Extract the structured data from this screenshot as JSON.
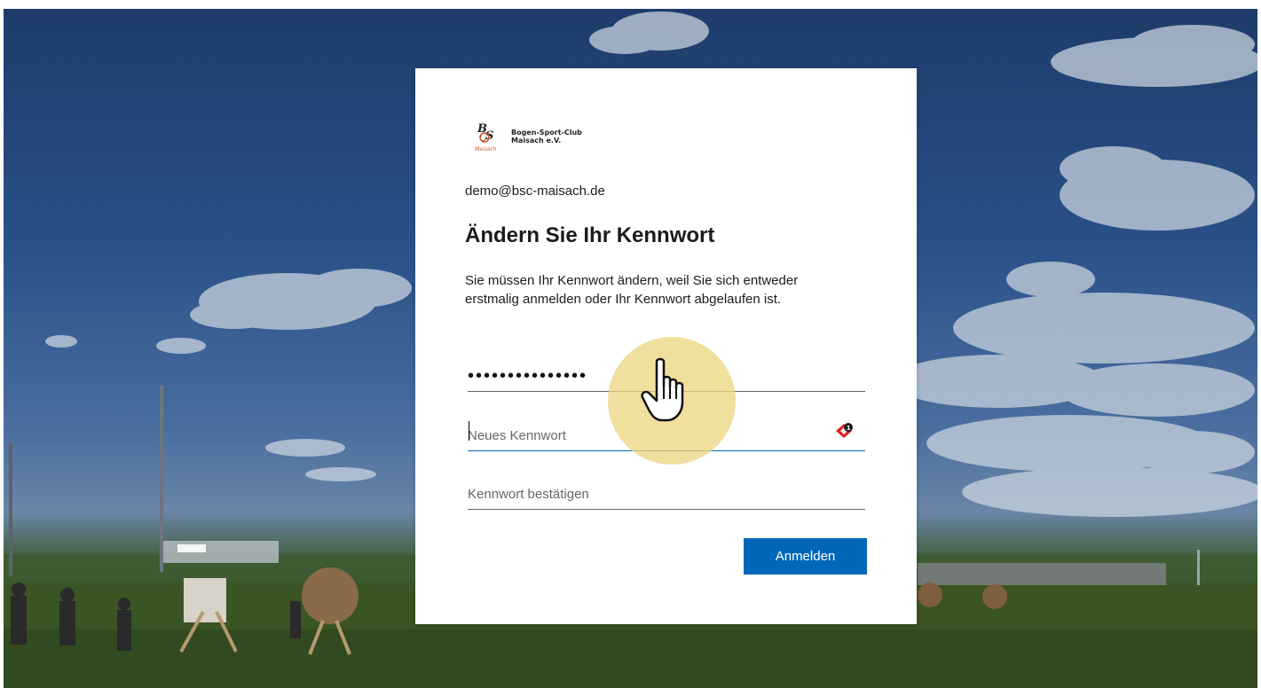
{
  "org": {
    "name_line1": "Bogen-Sport-Club",
    "name_line2": "Maisach e.V."
  },
  "account": {
    "email": "demo@bsc-maisach.de"
  },
  "heading": {
    "title": "Ändern Sie Ihr Kennwort",
    "description": "Sie müssen Ihr Kennwort ändern, weil Sie sich entweder erstmalig anmelden oder Ihr Kennwort abgelaufen ist."
  },
  "form": {
    "current_password_value": "•••••••••••••••",
    "new_password_placeholder": "Neues Kennwort",
    "confirm_password_placeholder": "Kennwort bestätigen",
    "submit_label": "Anmelden"
  },
  "colors": {
    "accent": "#0067b8",
    "cursor_highlight": "#ecd682"
  },
  "icons": {
    "password_manager": "password-manager-icon",
    "cursor": "hand-pointer-icon"
  }
}
